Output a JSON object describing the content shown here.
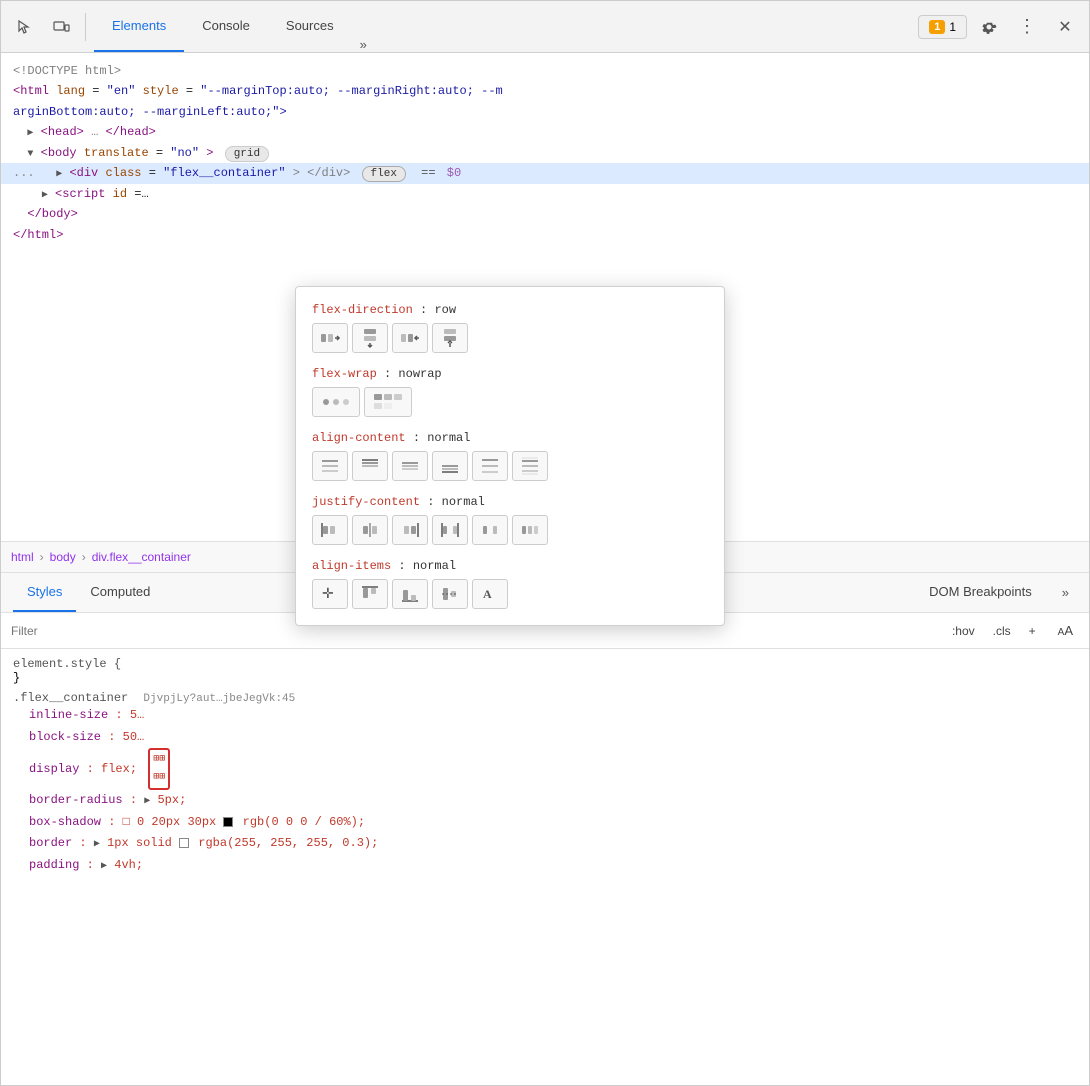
{
  "toolbar": {
    "cursor_icon": "⬚",
    "inspect_icon": "⬜",
    "tabs": [
      {
        "label": "Elements",
        "active": true
      },
      {
        "label": "Console",
        "active": false
      },
      {
        "label": "Sources",
        "active": false
      }
    ],
    "more_label": "»",
    "badge_count": "1",
    "settings_label": "⚙",
    "more_vert": "⋮",
    "close_label": "✕"
  },
  "html_panel": {
    "line1": "<!DOCTYPE html>",
    "line2_open": "<html",
    "line2_lang_attr": "lang",
    "line2_lang_val": "\"en\"",
    "line2_style_attr": "style",
    "line2_style_val": "\"--marginTop:auto; --marginRight:auto; --m",
    "line3": "arginBottom:auto; --marginLeft:auto;\">",
    "line4_tri": "▶",
    "line4": "<head>…</head>",
    "line5_tri": "▼",
    "line5_tag": "<body",
    "line5_attr": "translate",
    "line5_val": "\"no\"",
    "line5_badge": "grid",
    "line6_ellipsis": "...",
    "line6_tri": "▶",
    "line6_tag": "<div",
    "line6_class_attr": "class",
    "line6_class_val": "\"flex__container\"",
    "line6_partial": "</div",
    "line6_flex_badge": "flex",
    "line6_eq": "==",
    "line6_ref": "$0",
    "line7_tri": "▶",
    "line7_tag": "<script",
    "line7_attr": "id",
    "line7_val": "=…",
    "line8": "</body>",
    "line9": "</html>"
  },
  "breadcrumb": {
    "items": [
      "html",
      "body",
      "div.flex__container"
    ]
  },
  "styles_tabs": {
    "tabs": [
      "Styles",
      "Computed"
    ],
    "active": "Styles",
    "extra_tabs": [
      "DOM Breakpoints"
    ],
    "more_label": "»"
  },
  "filter_bar": {
    "placeholder": "Filter",
    "hov_label": ":hov",
    "cls_label": ".cls",
    "plus_label": "+",
    "font_label": "AA"
  },
  "styles_rules": [
    {
      "selector": "element.style {",
      "props": [],
      "close": "}"
    },
    {
      "selector": ".flex__container {",
      "props": [
        {
          "name": "inline-size:",
          "value": "5…"
        },
        {
          "name": "block-size:",
          "value": "50…"
        },
        {
          "name": "display:",
          "value": "flex;",
          "has_icon": true
        },
        {
          "name": "border-radius:",
          "value": "▶ 5px;"
        },
        {
          "name": "box-shadow:",
          "value": "□ 0 20px 30px ■ rgb(0 0 0 / 60%);"
        },
        {
          "name": "border:",
          "value": "▶ 1px solid □ rgba(255, 255, 255, 0.3);"
        },
        {
          "name": "padding:",
          "value": "▶ 4vh;"
        }
      ],
      "close": ""
    }
  ],
  "popup": {
    "flex_direction": {
      "label_prop": "flex-direction",
      "label_colon": ":",
      "label_val": "row",
      "buttons": [
        {
          "icon": "⬚→",
          "title": "row",
          "active": true
        },
        {
          "icon": "⬚↓",
          "title": "column"
        },
        {
          "icon": "⬚←",
          "title": "row-reverse"
        },
        {
          "icon": "⬚↑",
          "title": "column-reverse"
        }
      ]
    },
    "flex_wrap": {
      "label_prop": "flex-wrap",
      "label_colon": ":",
      "label_val": "nowrap",
      "buttons": [
        {
          "icon": "○○○",
          "title": "nowrap",
          "active": false
        },
        {
          "icon": "⊞⊞",
          "title": "wrap",
          "active": false
        }
      ]
    },
    "align_content": {
      "label_prop": "align-content",
      "label_colon": ":",
      "label_val": "normal",
      "buttons": [
        {
          "icon": "≡",
          "title": "normal"
        },
        {
          "icon": "≡↑",
          "title": "flex-start"
        },
        {
          "icon": "≡↕",
          "title": "center"
        },
        {
          "icon": "≡↓",
          "title": "flex-end"
        },
        {
          "icon": "≡⊕",
          "title": "space-between"
        },
        {
          "icon": "≡⊗",
          "title": "space-around"
        }
      ]
    },
    "justify_content": {
      "label_prop": "justify-content",
      "label_colon": ":",
      "label_val": "normal",
      "buttons": [
        {
          "icon": "|□□",
          "title": "flex-start"
        },
        {
          "icon": "□|□",
          "title": "center"
        },
        {
          "icon": "□□|",
          "title": "flex-end"
        },
        {
          "icon": "|□|□|",
          "title": "space-between"
        },
        {
          "icon": "□|□|□",
          "title": "space-around"
        },
        {
          "icon": "|□|□|",
          "title": "space-evenly"
        }
      ]
    },
    "align_items": {
      "label_prop": "align-items",
      "label_colon": ":",
      "label_val": "normal",
      "buttons": [
        {
          "icon": "✛",
          "title": "stretch"
        },
        {
          "icon": "⊤⊤",
          "title": "flex-start"
        },
        {
          "icon": "⊥⊥",
          "title": "flex-end"
        },
        {
          "icon": "—□—",
          "title": "center"
        },
        {
          "icon": "A",
          "title": "baseline"
        }
      ]
    }
  },
  "right_panel": {
    "url_text": "DjvpjLy?aut…jbeJegVk:45"
  }
}
